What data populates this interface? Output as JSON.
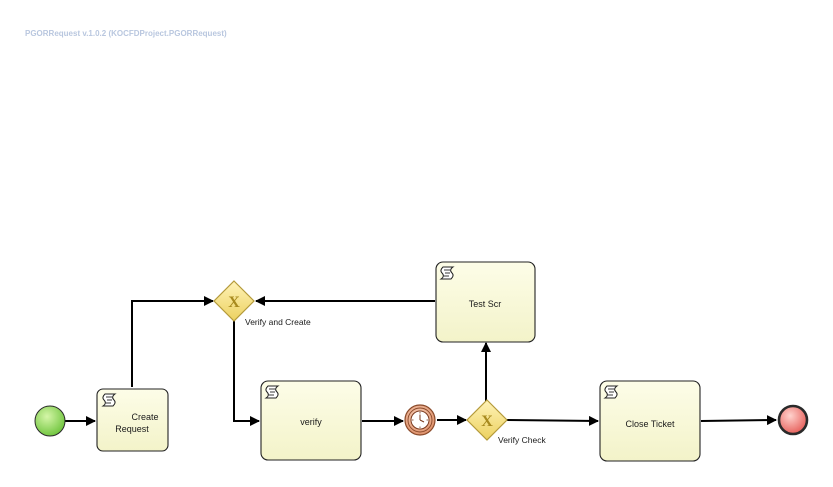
{
  "process": {
    "title": "PGORRequest v.1.0.2 (KOCFDProject.PGORRequest)"
  },
  "tasks": {
    "create_request": {
      "line1": "Create",
      "line2": "Request"
    },
    "verify": {
      "label": "verify"
    },
    "test_scr": {
      "label": "Test Scr"
    },
    "close_ticket": {
      "label": "Close Ticket"
    }
  },
  "gateways": {
    "verify_and_create": {
      "label": "Verify and Create",
      "marker": "X"
    },
    "verify_check": {
      "label": "Verify Check",
      "marker": "X"
    }
  },
  "colors": {
    "start_event": "#7ed448",
    "end_event": "#ef6b66",
    "timer_event": "#e39a74",
    "task_fill": "#fbfbdc",
    "gateway_fill": "#f6e08a",
    "title_text": "#b9c7df"
  },
  "icons": {
    "task": "script-icon",
    "timer": "clock-icon",
    "gateway": "exclusive-gateway-icon"
  }
}
